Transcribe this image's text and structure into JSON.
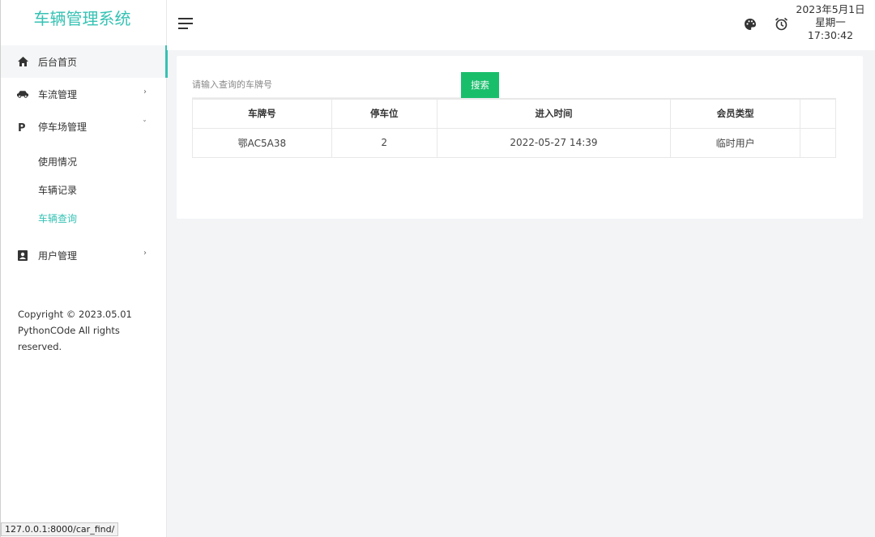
{
  "app": {
    "title": "车辆管理系统"
  },
  "sidebar": {
    "items": [
      {
        "label": "后台首页",
        "icon": "home-icon"
      },
      {
        "label": "车流管理",
        "icon": "car-icon"
      },
      {
        "label": "停车场管理",
        "icon": "parking-icon"
      },
      {
        "label": "用户管理",
        "icon": "user-card-icon"
      }
    ],
    "sub_items": [
      {
        "label": "使用情况"
      },
      {
        "label": "车辆记录"
      },
      {
        "label": "车辆查询"
      }
    ],
    "copyright": "Copyright © 2023.05.01 PythonCOde All rights reserved."
  },
  "topbar": {
    "date": "2023年5月1日",
    "weekday": "星期一",
    "time": "17:30:42"
  },
  "search": {
    "placeholder": "请输入查询的车牌号",
    "button_label": "搜索"
  },
  "table": {
    "headers": [
      "车牌号",
      "停车位",
      "进入时间",
      "会员类型",
      ""
    ],
    "rows": [
      [
        "鄂AC5A38",
        "2",
        "2022-05-27 14:39",
        "临时用户",
        ""
      ]
    ]
  },
  "status_bar": {
    "url": "127.0.0.1:8000/car_find/"
  },
  "colors": {
    "accent": "#36c2b4",
    "search_button": "#19be6b"
  }
}
